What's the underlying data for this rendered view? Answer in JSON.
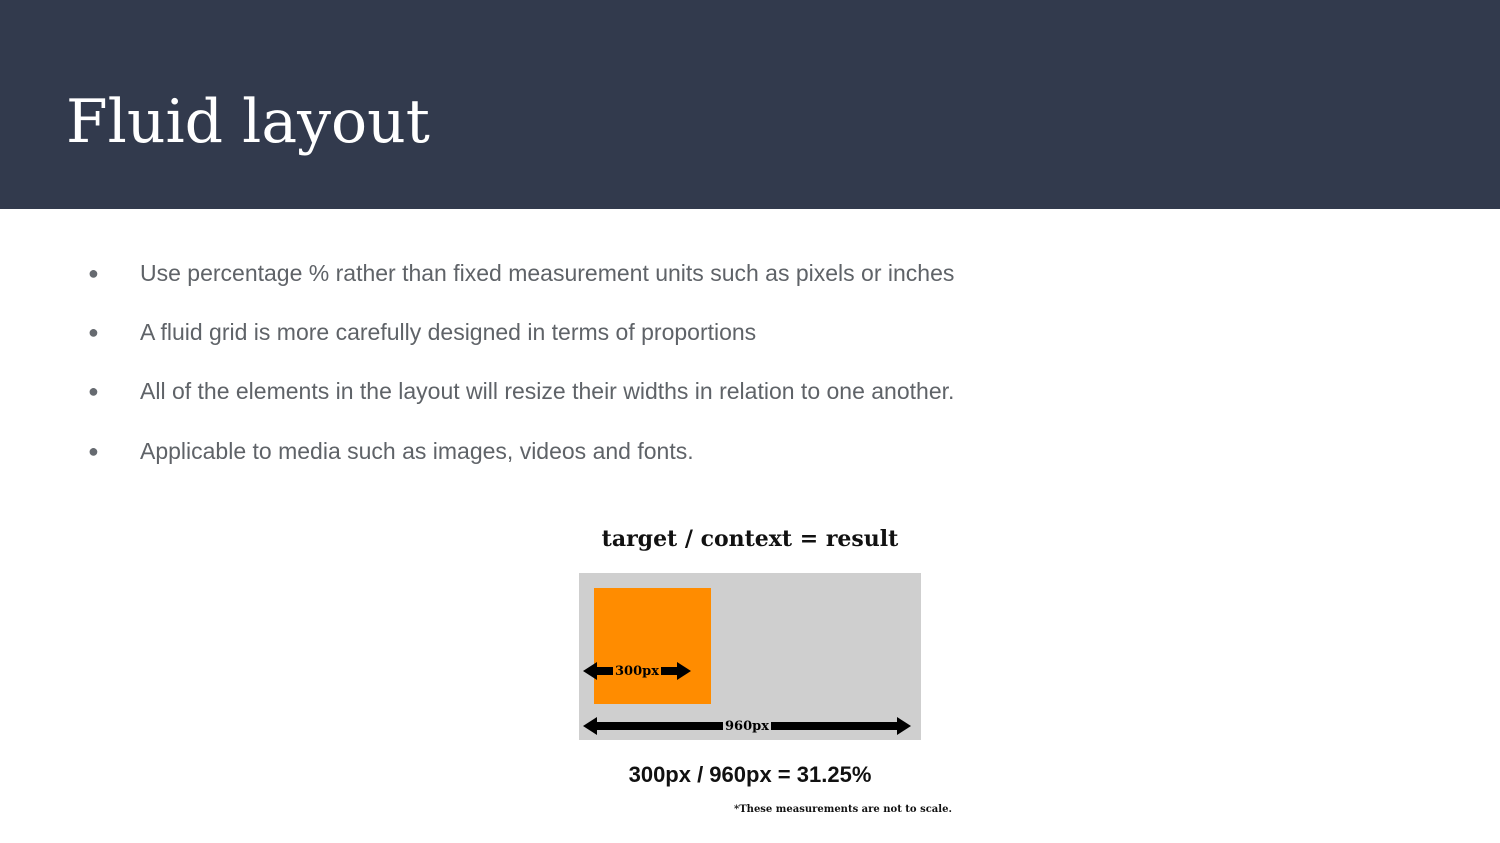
{
  "slide": {
    "title": "Fluid layout",
    "bullets": [
      "Use percentage % rather than fixed measurement units such as pixels or inches",
      "A fluid grid is more carefully designed in terms of proportions",
      "All of the elements in the layout will resize their widths in relation to one another.",
      "Applicable to media such as images, videos and fonts."
    ],
    "bullet_glyph": "●"
  },
  "figure": {
    "formula_top": "target / context = result",
    "target_label": "300px",
    "context_label": "960px",
    "formula_bottom": "300px / 960px = 31.25%",
    "note": "*These measurements are not to scale."
  },
  "colors": {
    "header_bg": "#323a4d",
    "title_text": "#ffffff",
    "body_text": "#5f6368",
    "figure_box": "#ff8c00",
    "figure_canvas": "#cfcfcf"
  }
}
